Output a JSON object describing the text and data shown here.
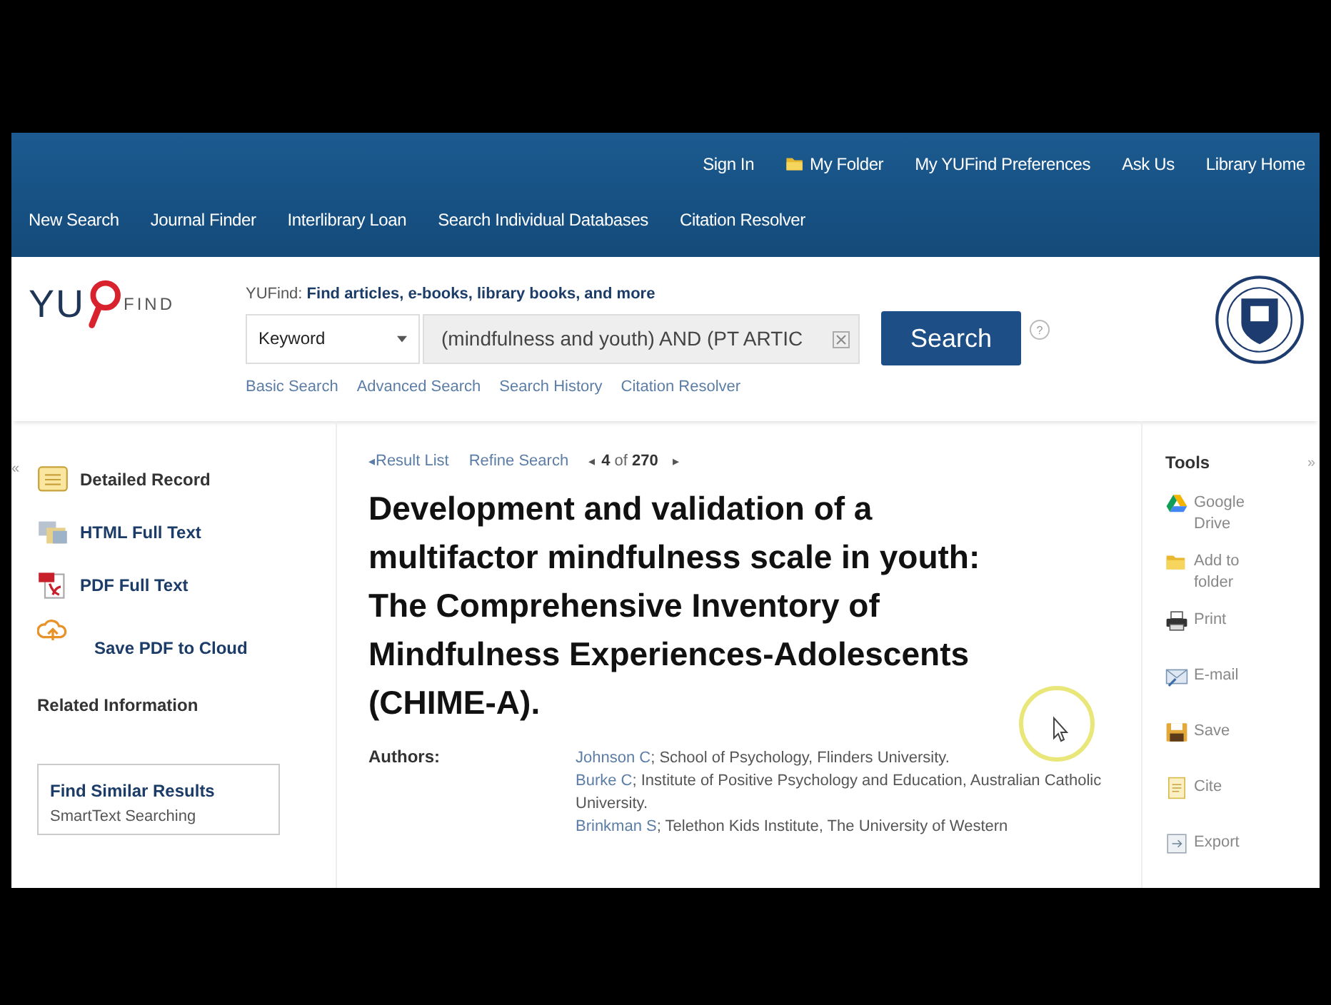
{
  "top_links": [
    {
      "label": "Sign In",
      "kind": "plain"
    },
    {
      "label": "My Folder",
      "kind": "folder"
    },
    {
      "label": "My YUFind Preferences",
      "kind": "plain"
    },
    {
      "label": "Ask Us",
      "kind": "plain"
    },
    {
      "label": "Library Home",
      "kind": "plain"
    }
  ],
  "main_nav": [
    "New Search",
    "Journal Finder",
    "Interlibrary Loan",
    "Search Individual Databases",
    "Citation Resolver"
  ],
  "logo": {
    "left": "YU",
    "right": "FIND"
  },
  "search": {
    "tagline": "YUFind: **Find articles, e-books, library books, and more**",
    "field_type": "Keyword",
    "query": "(mindfulness and youth) AND (PT ARTIC",
    "button": "Search",
    "help": "?",
    "links": [
      "Basic Search",
      "Advanced Search",
      "Search History",
      "Citation Resolver"
    ]
  },
  "left_panel": {
    "collapse": "«",
    "links": [
      {
        "label": "Detailed Record",
        "kind": "record"
      },
      {
        "label": "HTML Full Text",
        "kind": "html"
      },
      {
        "label": "PDF Full Text",
        "kind": "pdf"
      },
      {
        "label": "Save PDF to Cloud",
        "kind": "cloud"
      }
    ],
    "related_heading": "Related Information",
    "related_box": {
      "title": "Find Similar Results",
      "link": "SmartText Searching"
    }
  },
  "record_nav": {
    "back_arrow": "◂",
    "back": "Result List",
    "refine": "Refine Search",
    "prev": "◂",
    "position": "**4** of **270**",
    "next": "▸"
  },
  "title": "Development and validation of a multifactor mindfulness scale in youth: The Comprehensive Inventory of Mindfulness Experiences-Adolescents (CHIME-A).",
  "authors": {
    "label": "Authors:",
    "entries": [
      {
        "name": "Johnson C",
        "affiliation": "; School of Psychology, Flinders University."
      },
      {
        "name": "Burke C",
        "affiliation": "; Institute of Positive Psychology and Education, Australian Catholic University."
      },
      {
        "name": "Brinkman S",
        "affiliation": "; Telethon Kids Institute, The University of Western"
      }
    ]
  },
  "tools": {
    "heading": "Tools",
    "expand": "»",
    "items": [
      {
        "label": "Google Drive",
        "kind": "drive"
      },
      {
        "label": "Add to folder",
        "kind": "folder"
      },
      {
        "label": "Print",
        "kind": "print"
      },
      {
        "label": "E-mail",
        "kind": "email"
      },
      {
        "label": "Save",
        "kind": "save"
      },
      {
        "label": "Cite",
        "kind": "cite"
      },
      {
        "label": "Export",
        "kind": "export"
      }
    ]
  }
}
